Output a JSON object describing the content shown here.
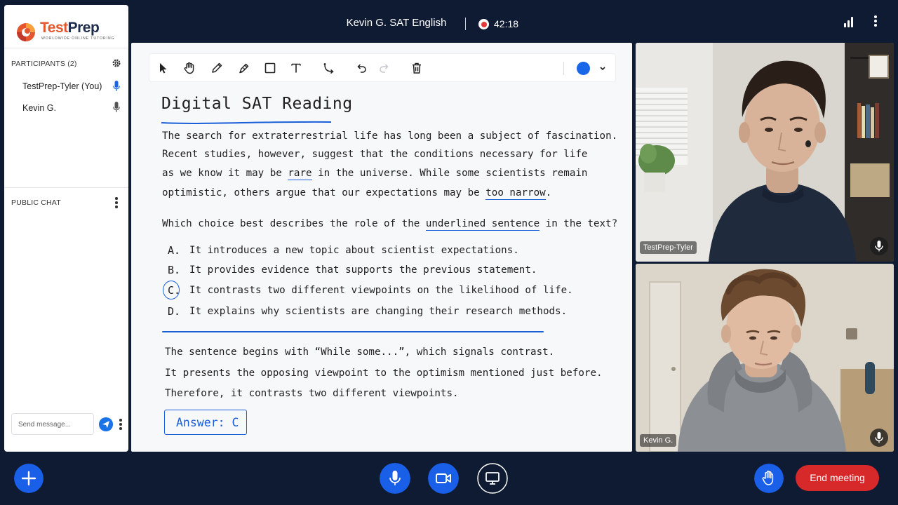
{
  "header": {
    "meeting_title": "Kevin G.  SAT English",
    "recording_time": "42:18"
  },
  "brand": {
    "name_part1": "Test",
    "name_part2": "Prep",
    "tagline": "WORLDWIDE ONLINE TUTORING"
  },
  "sidebar": {
    "participants_title": "PARTICIPANTS (2)",
    "participants": [
      {
        "name": "TestPrep-Tyler (You)",
        "mic": "active"
      },
      {
        "name": "Kevin G.",
        "mic": "muted-gray"
      }
    ],
    "chat_title": "PUBLIC CHAT",
    "chat_placeholder": "Send message..."
  },
  "whiteboard": {
    "tools": [
      "select-icon",
      "hand-icon",
      "pencil-icon",
      "marker-icon",
      "rectangle-icon",
      "text-icon",
      "connector-icon",
      "undo-icon",
      "redo-icon",
      "trash-icon"
    ],
    "selected_color": "#1a66e8",
    "title": "Digital SAT Reading",
    "passage": {
      "line1": "The search for extraterrestrial life has long been a subject of fascination.",
      "line2": "Recent studies, however, suggest that the conditions necessary for life",
      "line3_a": "as we know it may be ",
      "line3_ul": "rare",
      "line3_b": " in the universe. While some scientists remain",
      "line4_a": "optimistic, others argue that our expectations may be ",
      "line4_ul": "too narrow",
      "line4_b": "."
    },
    "question": {
      "q_a": "Which choice best describes the role of the ",
      "q_ul": "underlined sentence",
      "q_b": " in the text?"
    },
    "choices": [
      {
        "letter": "A.",
        "text": "It introduces a new topic about scientist expectations."
      },
      {
        "letter": "B.",
        "text": "It provides evidence that supports the previous statement."
      },
      {
        "letter": "C.",
        "text": "It contrasts two different viewpoints on the likelihood of life."
      },
      {
        "letter": "D.",
        "text": "It explains why scientists are changing their research methods."
      }
    ],
    "explanation": [
      "The sentence begins with “While some...”, which signals contrast.",
      "It presents the opposing viewpoint to the optimism mentioned just before.",
      "Therefore, it contrasts two different viewpoints."
    ],
    "answer": "Answer: C"
  },
  "videos": [
    {
      "name": "TestPrep-Tyler"
    },
    {
      "name": "Kevin G."
    }
  ],
  "controls": {
    "end_label": "End meeting",
    "accent": "#1a5fe8",
    "end_color": "#d7282a"
  }
}
